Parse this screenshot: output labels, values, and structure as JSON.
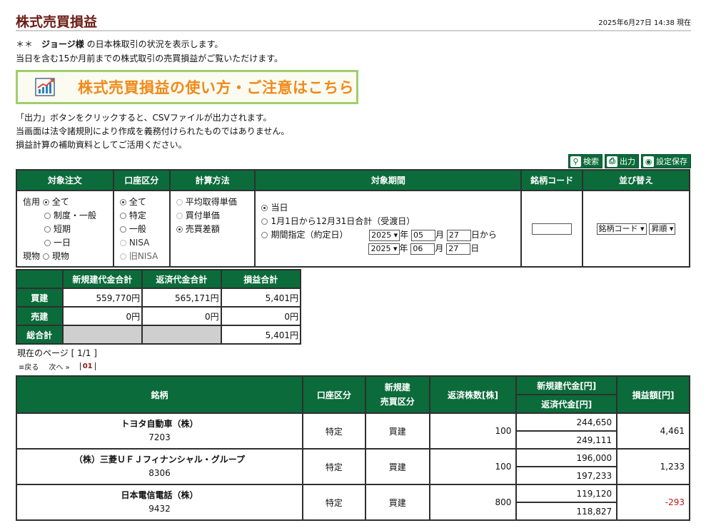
{
  "header": {
    "title": "株式売買損益",
    "timestamp": "2025年6月27日 14:38 現在"
  },
  "intro": {
    "line1_prefix": "＊＊　",
    "user": "ジョージ様",
    "line1_suffix": " の日本株取引の状況を表示します。",
    "line2": "当日を含む15か月前までの株式取引の売買損益がご覧いただけます。"
  },
  "banner": {
    "text": "株式売買損益の使い方・ご注意はこちら",
    "icon": "chart-up-icon"
  },
  "notes": [
    "「出力」ボタンをクリックすると、CSVファイルが出力されます。",
    "当画面は法令諸規則により作成を義務付けられたものではありません。",
    "損益計算の補助資料としてご活用ください。"
  ],
  "tools": [
    {
      "label": "検索",
      "icon": "magnifier-icon"
    },
    {
      "label": "出力",
      "icon": "printer-icon"
    },
    {
      "label": "設定保存",
      "icon": "gear-icon"
    }
  ],
  "filter": {
    "headers": [
      "対象注文",
      "口座区分",
      "計算方法",
      "対象期間",
      "銘柄コード",
      "並び替え"
    ],
    "order": {
      "credit_label": "信用",
      "cash_label": "現物",
      "options": [
        "全て",
        "制度・一般",
        "短期",
        "一日",
        "現物"
      ],
      "selected": "全て"
    },
    "account": {
      "options": [
        "全て",
        "特定",
        "一般",
        "NISA",
        "旧NISA"
      ],
      "selected": "全て"
    },
    "method": {
      "options": [
        "平均取得単価",
        "買付単価",
        "売買差額"
      ],
      "selected": "売買差額"
    },
    "period": {
      "options": [
        "当日",
        "1月1日から12月31日合計（受渡日）",
        "期間指定（約定日）"
      ],
      "selected": "当日",
      "from": {
        "year": "2025",
        "month": "05",
        "day": "27",
        "suffix": "日から"
      },
      "to": {
        "year": "2025",
        "month": "06",
        "day": "27",
        "suffix": "日"
      },
      "year_unit": "年",
      "month_unit": "月"
    },
    "code_value": "",
    "sort": {
      "field": "銘柄コード",
      "order": "昇順"
    }
  },
  "summary": {
    "headers": [
      "",
      "新規建代金合計",
      "返済代金合計",
      "損益合計"
    ],
    "rows": [
      {
        "label": "買建",
        "new": "559,770円",
        "ret": "565,171円",
        "pl": "5,401円"
      },
      {
        "label": "売建",
        "new": "0円",
        "ret": "0円",
        "pl": "0円"
      },
      {
        "label": "総合計",
        "new": "",
        "ret": "",
        "pl": "5,401円"
      }
    ]
  },
  "pager": {
    "current": "現在のページ [ 1/1 ]",
    "prev": "戻る",
    "next": "次へ",
    "page": "01"
  },
  "results": {
    "headers": {
      "name": "銘柄",
      "account": "口座区分",
      "type": "新規建\n売買区分",
      "qty": "返済株数[株]",
      "new_amt": "新規建代金[円]",
      "ret_amt": "返済代金[円]",
      "pl": "損益額[円]"
    },
    "rows": [
      {
        "name": "トヨタ自動車（株）",
        "code": "7203",
        "account": "特定",
        "type": "買建",
        "qty": "100",
        "new_amt": "244,650",
        "ret_amt": "249,111",
        "pl": "4,461",
        "negative": false
      },
      {
        "name": "（株）三菱ＵＦＪフィナンシャル・グループ",
        "code": "8306",
        "account": "特定",
        "type": "買建",
        "qty": "100",
        "new_amt": "196,000",
        "ret_amt": "197,233",
        "pl": "1,233",
        "negative": false
      },
      {
        "name": "日本電信電話（株）",
        "code": "9432",
        "account": "特定",
        "type": "買建",
        "qty": "800",
        "new_amt": "119,120",
        "ret_amt": "118,827",
        "pl": "-293",
        "negative": true
      }
    ]
  },
  "colors": {
    "header_green": "#0b6b3a",
    "title_maroon": "#6b1d14",
    "banner_orange": "#f08a1a",
    "negative_red": "#c01818"
  }
}
